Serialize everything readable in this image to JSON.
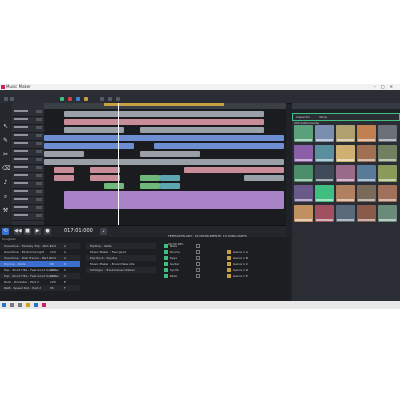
{
  "window": {
    "title": "Music Maker"
  },
  "menu": [
    "Datei",
    "Bearbeiten",
    "Ansicht",
    "Extras",
    "Hilfe"
  ],
  "transport": {
    "timecode": "017:01:000"
  },
  "right_panel": {
    "tabs": [
      "Inspector",
      "Store"
    ],
    "list_label": "VST-Instrumente"
  },
  "bottom": {
    "col_title": "Songtitel",
    "songs": [
      {
        "name": "Overdrive - Fantasy Trip - Part 2",
        "a": "124",
        "b": "A"
      },
      {
        "name": "Overdrive - Eindrücke light",
        "a": "124",
        "b": "A"
      },
      {
        "name": "Overdrive - Disk Trance - Part 2",
        "a": "124",
        "b": "A"
      },
      {
        "name": "Hiphop - Skills",
        "a": "88",
        "b": "D"
      },
      {
        "name": "Pop - Short Hits - Feel Good Summer",
        "a": "100",
        "b": "C"
      },
      {
        "name": "Pop - Short Hits - Feel Good Summer",
        "a": "100",
        "b": "C"
      },
      {
        "name": "Rock - Rockstar - Part 2",
        "a": "120",
        "b": "E"
      },
      {
        "name": "R&B - Speed Roll - Part 2",
        "a": "95",
        "b": "F"
      }
    ],
    "mid_list": [
      "HipHop - Skills",
      "Music Maker - Feel good",
      "Pop Rock - Skyline",
      "Music Maker - Brand New Life",
      "Schlager - Traumreisen Italien"
    ],
    "categories": [
      "Bass",
      "Drums",
      "Keys",
      "Guitar",
      "Synth",
      "Pads"
    ],
    "genres": [
      "Genre 1 A",
      "Genre 1 B",
      "Genre 1 C",
      "Genre 1 D",
      "Genre 1 E"
    ],
    "info_text": "FERTIGSTELLEN - 33 INSTRUMENTE, 15 SONG PARTS",
    "time_text": "00:00 SEC"
  },
  "colors": {
    "accent_green": "#3fbf7f",
    "clip_gray": "#9aa0a8",
    "clip_pink": "#c98d9a",
    "clip_purple": "#a883c8",
    "clip_blue": "#6d8ed3",
    "clip_green": "#6fb87a",
    "clip_teal": "#5da8b0"
  }
}
